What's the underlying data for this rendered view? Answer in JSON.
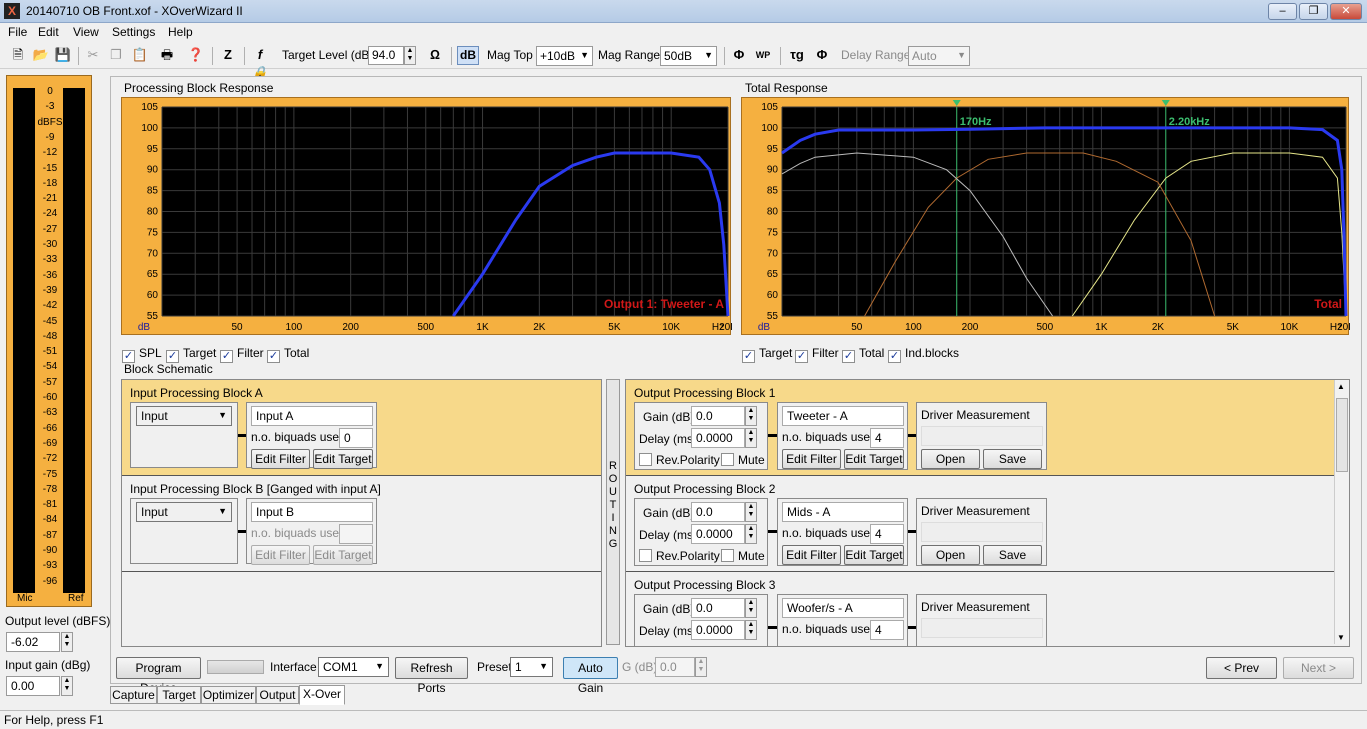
{
  "window": {
    "title": "20140710 OB Front.xof - XOverWizard II",
    "icon": "X"
  },
  "menu": [
    "File",
    "Edit",
    "View",
    "Settings",
    "Help"
  ],
  "toolbar": {
    "target_level_label": "Target Level (dB)",
    "target_level_value": "94.0",
    "db_toggle": "dB",
    "mag_top_label": "Mag Top",
    "mag_top_value": "+10dB",
    "mag_range_label": "Mag Range",
    "mag_range_value": "50dB",
    "wp_icon": "WP",
    "delay_range_label": "Delay Range",
    "delay_range_value": "Auto"
  },
  "meter": {
    "ticks": [
      "0",
      "-3",
      "dBFS",
      "-9",
      "-12",
      "-15",
      "-18",
      "-21",
      "-24",
      "-27",
      "-30",
      "-33",
      "-36",
      "-39",
      "-42",
      "-45",
      "-48",
      "-51",
      "-54",
      "-57",
      "-60",
      "-63",
      "-66",
      "-69",
      "-72",
      "-75",
      "-78",
      "-81",
      "-84",
      "-87",
      "-90",
      "-93",
      "-96"
    ],
    "mic_label": "Mic",
    "ref_label": "Ref",
    "output_level_label": "Output level (dBFS)",
    "output_level_value": "-6.02",
    "input_gain_label": "Input gain (dBg)",
    "input_gain_value": "0.00"
  },
  "chart_data": [
    {
      "type": "line",
      "title": "Processing Block Response",
      "overlay_label": "Output 1: Tweeter - A",
      "x_scale": "log",
      "xlim": [
        20,
        20000
      ],
      "ylim": [
        55,
        105
      ],
      "x_ticks": [
        "50",
        "100",
        "200",
        "500",
        "1K",
        "2K",
        "5K",
        "10K",
        "20K",
        "Hz"
      ],
      "y_ticks": [
        "105",
        "100",
        "95",
        "90",
        "85",
        "80",
        "75",
        "70",
        "65",
        "60",
        "55"
      ],
      "unit_label": "dB",
      "series": [
        {
          "color": "#2a3af0",
          "x": [
            700,
            1000,
            1500,
            2000,
            3000,
            4000,
            5000,
            7000,
            10000,
            14000,
            16000,
            18000,
            19000,
            20000
          ],
          "y": [
            55,
            65,
            78,
            86,
            91,
            93,
            94,
            94,
            94,
            93,
            90,
            82,
            72,
            55
          ]
        }
      ]
    },
    {
      "type": "line",
      "title": "Total Response",
      "overlay_label": "Total",
      "x_scale": "log",
      "xlim": [
        20,
        20000
      ],
      "ylim": [
        55,
        105
      ],
      "x_ticks": [
        "50",
        "100",
        "200",
        "500",
        "1K",
        "2K",
        "5K",
        "10K",
        "20K",
        "Hz"
      ],
      "y_ticks": [
        "105",
        "100",
        "95",
        "90",
        "85",
        "80",
        "75",
        "70",
        "65",
        "60",
        "55"
      ],
      "unit_label": "dB",
      "markers": [
        {
          "x": 170,
          "label": "170Hz"
        },
        {
          "x": 2200,
          "label": "2.20kHz"
        }
      ],
      "series": [
        {
          "color": "#2a3af0",
          "x": [
            20,
            25,
            30,
            40,
            60,
            100,
            200,
            500,
            1000,
            2000,
            5000,
            10000,
            15000,
            18000,
            19000,
            19500,
            20000
          ],
          "y": [
            94,
            97,
            98.5,
            99.5,
            99.5,
            99.5,
            99.7,
            100,
            100,
            100,
            100,
            100,
            99.6,
            97,
            90,
            75,
            55
          ]
        },
        {
          "color": "#bbbbbb",
          "x": [
            20,
            25,
            30,
            50,
            100,
            150,
            200,
            300,
            400,
            550
          ],
          "y": [
            89,
            91.5,
            93,
            94,
            93,
            90,
            85,
            74,
            64,
            55
          ]
        },
        {
          "color": "#b06a30",
          "x": [
            55,
            80,
            120,
            170,
            250,
            400,
            800,
            1200,
            2000,
            3000,
            4000
          ],
          "y": [
            55,
            68,
            81,
            88,
            92.5,
            94,
            94,
            92,
            87,
            73,
            55
          ]
        },
        {
          "color": "#e6e68a",
          "x": [
            700,
            1000,
            1500,
            2200,
            3000,
            5000,
            10000,
            15000,
            18000,
            19000,
            20000
          ],
          "y": [
            55,
            65,
            78,
            88,
            92,
            94,
            94,
            93,
            88,
            75,
            55
          ]
        }
      ]
    }
  ],
  "left_checks": [
    "SPL",
    "Target",
    "Filter",
    "Total"
  ],
  "right_checks": [
    "Target",
    "Filter",
    "Total",
    "Ind.blocks"
  ],
  "schematic": {
    "title": "Block Schematic",
    "input_blocks": [
      {
        "title": "Input Processing Block A",
        "source": "Input",
        "name": "Input A",
        "biquads_label": "n.o. biquads used",
        "biquads": "0",
        "edit_filter": "Edit Filter",
        "edit_target": "Edit Target"
      },
      {
        "title": "Input Processing Block B [Ganged with input A]",
        "source": "Input",
        "name": "Input B",
        "biquads_label": "n.o. biquads used",
        "biquads": "",
        "edit_filter": "Edit Filter",
        "edit_target": "Edit Target"
      }
    ],
    "routing": "ROUTING",
    "output_blocks": [
      {
        "title": "Output Processing Block 1",
        "gain_label": "Gain (dB)",
        "gain": "0.0",
        "delay_label": "Delay (ms)",
        "delay": "0.0000",
        "rev_label": "Rev.Polarity",
        "mute_label": "Mute",
        "name": "Tweeter - A",
        "biquads_label": "n.o. biquads used",
        "biquads": "4",
        "edit_filter": "Edit Filter",
        "edit_target": "Edit Target",
        "meas_label": "Driver Measurement",
        "open": "Open",
        "save": "Save"
      },
      {
        "title": "Output Processing Block 2",
        "gain_label": "Gain (dB)",
        "gain": "0.0",
        "delay_label": "Delay (ms)",
        "delay": "0.0000",
        "rev_label": "Rev.Polarity",
        "mute_label": "Mute",
        "name": "Mids - A",
        "biquads_label": "n.o. biquads used",
        "biquads": "4",
        "edit_filter": "Edit Filter",
        "edit_target": "Edit Target",
        "meas_label": "Driver Measurement",
        "open": "Open",
        "save": "Save"
      },
      {
        "title": "Output Processing Block 3",
        "gain_label": "Gain (dB)",
        "gain": "0.0",
        "delay_label": "Delay (ms)",
        "delay": "0.0000",
        "name": "Woofer/s - A",
        "biquads_label": "n.o. biquads used",
        "biquads": "4",
        "meas_label": "Driver Measurement"
      }
    ]
  },
  "bottom": {
    "program_device": "Program Device",
    "interface_label": "Interface",
    "interface_value": "COM1",
    "refresh_ports": "Refresh Ports",
    "preset_label": "Preset",
    "preset_value": "1",
    "auto_gain": "Auto Gain",
    "g_label": "G (dB)",
    "g_value": "0.0",
    "prev": "< Prev",
    "next": "Next >"
  },
  "tabs": [
    "Capture",
    "Target",
    "Optimizer",
    "Output",
    "X-Over"
  ],
  "active_tab": "X-Over",
  "status": "For Help, press F1"
}
